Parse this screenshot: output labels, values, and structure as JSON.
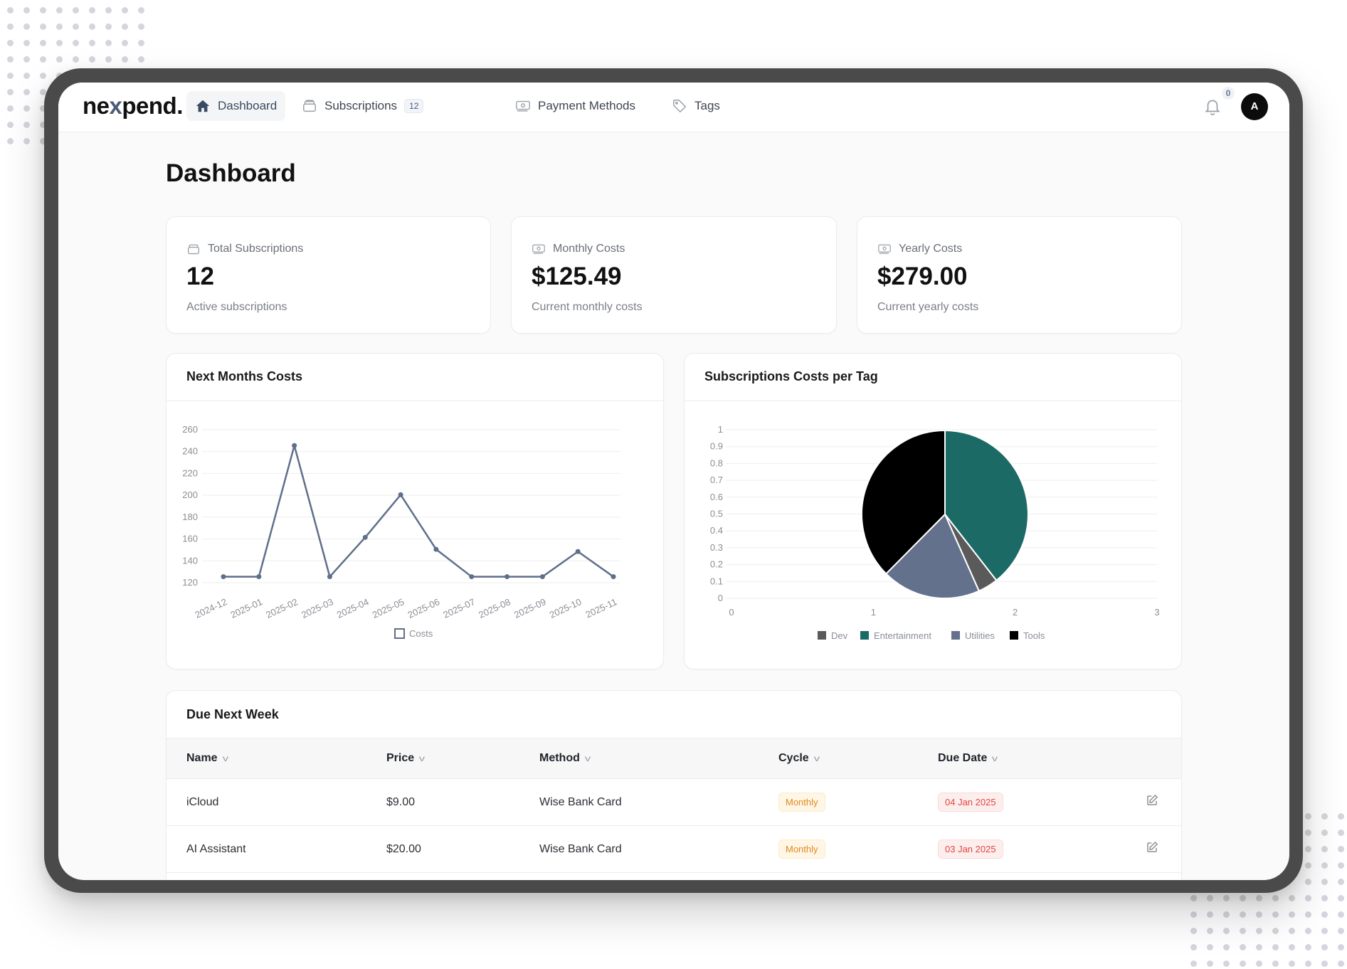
{
  "app": {
    "logo_prefix": "ne",
    "logo_x": "x",
    "logo_suffix": "pend."
  },
  "nav": {
    "items": [
      {
        "label": "Dashboard",
        "icon": "home-icon",
        "active": true
      },
      {
        "label": "Subscriptions",
        "icon": "box-icon",
        "badge": "12"
      },
      {
        "label": "Payment Methods",
        "icon": "cash-icon"
      },
      {
        "label": "Tags",
        "icon": "tag-icon"
      }
    ],
    "notification_count": "0",
    "avatar_initial": "A"
  },
  "page": {
    "title": "Dashboard"
  },
  "stats": [
    {
      "label": "Total Subscriptions",
      "icon": "box-icon",
      "value": "12",
      "sub": "Active subscriptions"
    },
    {
      "label": "Monthly Costs",
      "icon": "cash-icon",
      "value": "$125.49",
      "sub": "Current monthly costs"
    },
    {
      "label": "Yearly Costs",
      "icon": "cash-icon",
      "value": "$279.00",
      "sub": "Current yearly costs"
    }
  ],
  "colors": {
    "line": "#5f6f8a",
    "dev": "#5a5a5a",
    "entertainment": "#1c6a66",
    "utilities": "#64718c",
    "tools": "#000000"
  },
  "chart_data": [
    {
      "type": "line",
      "title": "Next Months Costs",
      "categories": [
        "2024-12",
        "2025-01",
        "2025-02",
        "2025-03",
        "2025-04",
        "2025-05",
        "2025-06",
        "2025-07",
        "2025-08",
        "2025-09",
        "2025-10",
        "2025-11"
      ],
      "series": [
        {
          "name": "Costs",
          "values": [
            125.49,
            125.49,
            245.49,
            125.49,
            161.49,
            200.49,
            150.49,
            125.49,
            125.49,
            125.49,
            148.49,
            125.49
          ]
        }
      ],
      "yticks": [
        120,
        140,
        160,
        180,
        200,
        220,
        240,
        260
      ],
      "ylim": [
        120,
        260
      ],
      "grid": true,
      "legend": "bottom"
    },
    {
      "type": "pie",
      "title": "Subscriptions Costs per Tag",
      "categories": [
        "Dev",
        "Entertainment",
        "Utilities",
        "Tools"
      ],
      "values": [
        3.9,
        39.4,
        19.2,
        37.5
      ],
      "slice_order_clockwise_from_top": [
        "Entertainment",
        "Dev",
        "Utilities",
        "Tools"
      ],
      "xticks": [
        "0",
        "1",
        "2",
        "3"
      ],
      "yticks": [
        "0",
        "0.1",
        "0.2",
        "0.3",
        "0.4",
        "0.5",
        "0.6",
        "0.7",
        "0.8",
        "0.9",
        "1"
      ],
      "grid": true,
      "legend": "bottom"
    }
  ],
  "due": {
    "title": "Due Next Week",
    "columns": [
      "Name",
      "Price",
      "Method",
      "Cycle",
      "Due Date"
    ],
    "rows": [
      {
        "name": "iCloud",
        "price": "$9.00",
        "method": "Wise Bank Card",
        "cycle": "Monthly",
        "due": "04 Jan 2025"
      },
      {
        "name": "AI Assistant",
        "price": "$20.00",
        "method": "Wise Bank Card",
        "cycle": "Monthly",
        "due": "03 Jan 2025"
      }
    ]
  }
}
